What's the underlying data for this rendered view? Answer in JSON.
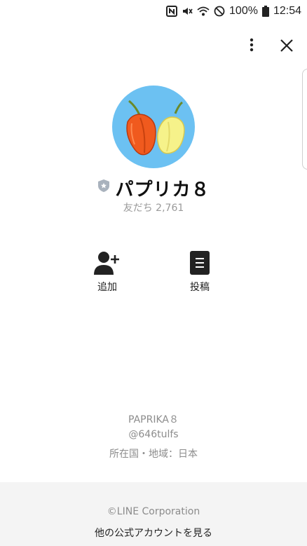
{
  "status_bar": {
    "battery": "100%",
    "time": "12:54",
    "icons": [
      "nfc-icon",
      "mute-icon",
      "wifi-icon",
      "do-not-disturb-icon",
      "battery-icon"
    ]
  },
  "toolbar": {
    "more_icon": "more-vertical-icon",
    "close_icon": "close-icon"
  },
  "profile": {
    "name": "パプリカ８",
    "friends_label": "友だち 2,761",
    "badge_icon": "verified-shield-icon",
    "avatar_image": "paprika-peppers"
  },
  "actions": [
    {
      "label": "追加",
      "icon": "add-friend-icon"
    },
    {
      "label": "投稿",
      "icon": "post-icon"
    }
  ],
  "info": {
    "account_name": "PAPRIKA８",
    "line_id": "@646tulfs",
    "region": "所在国・地域：日本"
  },
  "footer": {
    "copyright": "©LINE Corporation",
    "more_accounts": "他の公式アカウントを見る"
  },
  "colors": {
    "avatar_bg": "#6cc1f2",
    "pepper_red": "#f05a1e",
    "pepper_yellow": "#f6f28a",
    "footer_bg": "#f4f4f4",
    "muted_text": "#8c8c8c"
  }
}
